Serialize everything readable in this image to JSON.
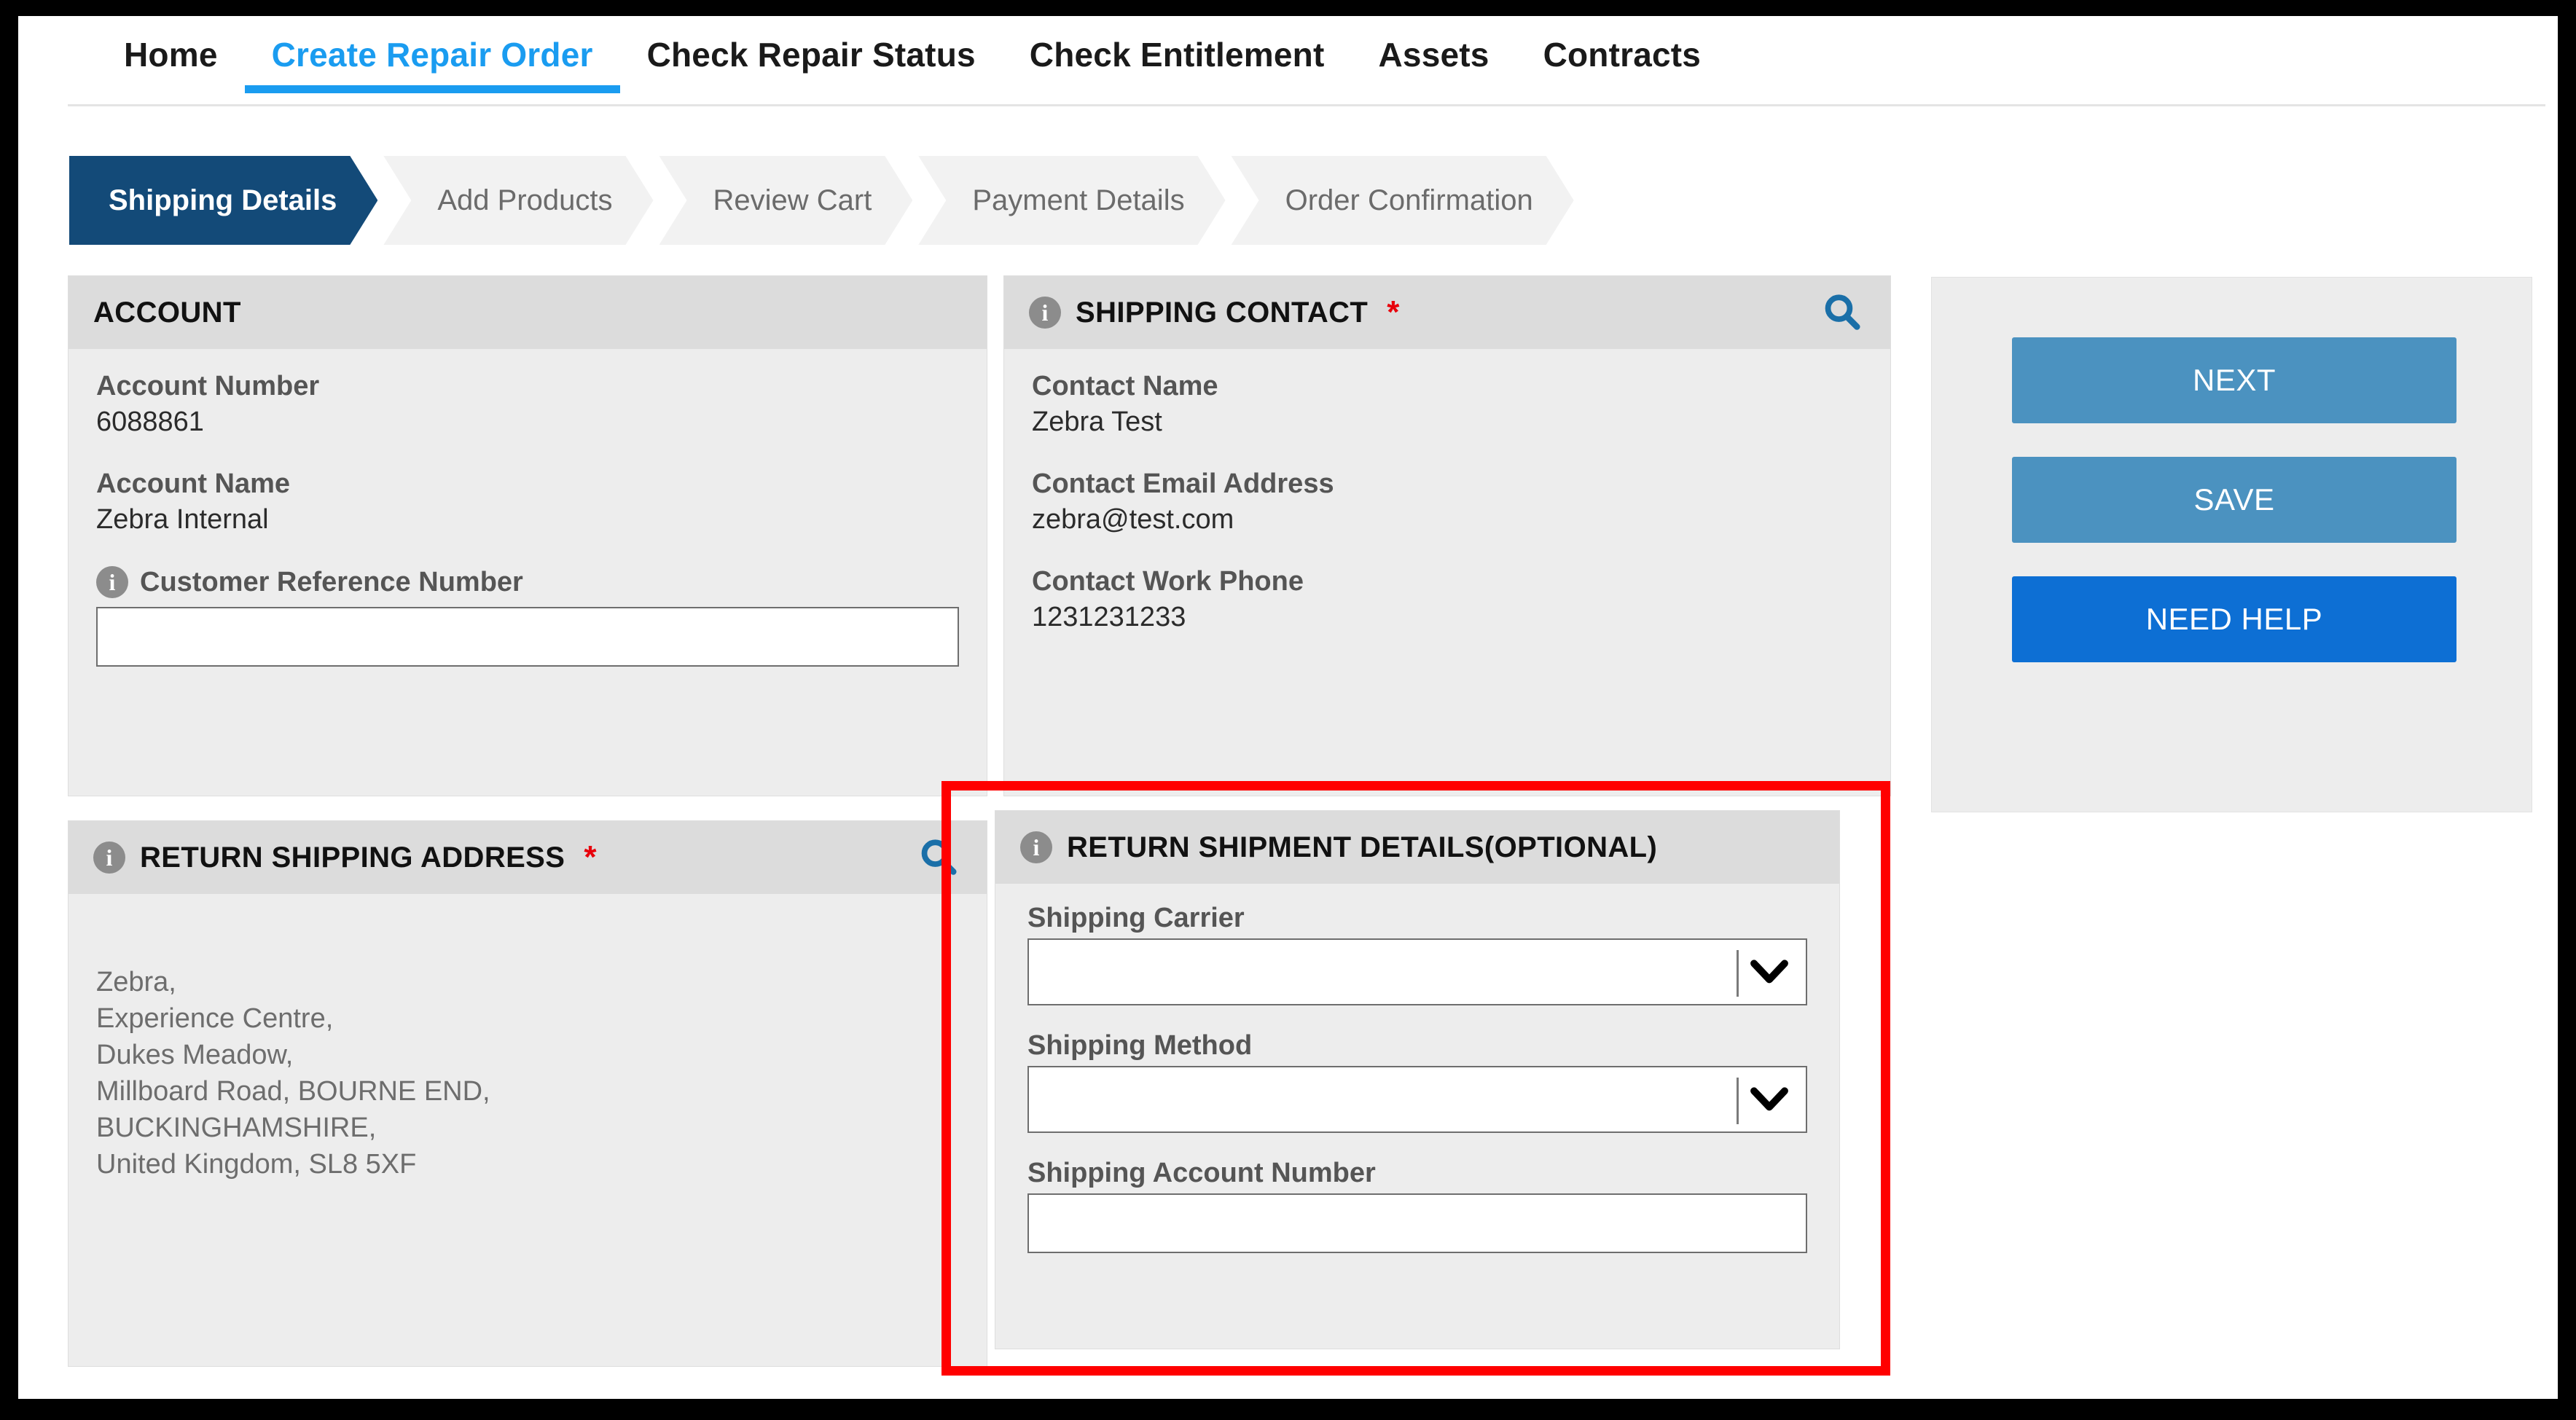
{
  "nav": {
    "items": [
      {
        "label": "Home",
        "active": false
      },
      {
        "label": "Create Repair Order",
        "active": true
      },
      {
        "label": "Check Repair Status",
        "active": false
      },
      {
        "label": "Check Entitlement",
        "active": false
      },
      {
        "label": "Assets",
        "active": false
      },
      {
        "label": "Contracts",
        "active": false
      }
    ]
  },
  "stepper": {
    "steps": [
      {
        "label": "Shipping Details",
        "active": true
      },
      {
        "label": "Add Products",
        "active": false
      },
      {
        "label": "Review Cart",
        "active": false
      },
      {
        "label": "Payment Details",
        "active": false
      },
      {
        "label": "Order Confirmation",
        "active": false
      }
    ]
  },
  "account_panel": {
    "title": "ACCOUNT",
    "account_number_label": "Account Number",
    "account_number_value": "6088861",
    "account_name_label": "Account Name",
    "account_name_value": "Zebra Internal",
    "customer_reference_label": "Customer Reference Number",
    "customer_reference_value": "",
    "customer_reference_placeholder": ""
  },
  "shipping_contact_panel": {
    "title": "SHIPPING CONTACT",
    "required_marker": "*",
    "contact_name_label": "Contact Name",
    "contact_name_value": "Zebra Test",
    "contact_email_label": "Contact Email Address",
    "contact_email_value": "zebra@test.com",
    "contact_phone_label": "Contact Work Phone",
    "contact_phone_value": "1231231233"
  },
  "return_shipping_address_panel": {
    "title": "RETURN SHIPPING ADDRESS",
    "required_marker": "*",
    "address": "Zebra,\nExperience Centre,\nDukes Meadow,\nMillboard Road, BOURNE END,\nBUCKINGHAMSHIRE,\nUnited Kingdom, SL8 5XF"
  },
  "return_shipment_details_panel": {
    "title": "RETURN SHIPMENT DETAILS(OPTIONAL)",
    "shipping_carrier_label": "Shipping Carrier",
    "shipping_carrier_value": "",
    "shipping_method_label": "Shipping Method",
    "shipping_method_value": "",
    "shipping_account_number_label": "Shipping Account Number",
    "shipping_account_number_value": "",
    "shipping_account_number_placeholder": ""
  },
  "actions": {
    "next_label": "NEXT",
    "save_label": "SAVE",
    "need_help_label": "NEED HELP"
  },
  "icons": {
    "info": "info-icon",
    "search": "search-icon",
    "chevron_down": "chevron-down-icon"
  },
  "colors": {
    "accent_blue": "#1a9cf0",
    "step_active": "#134a78",
    "button_secondary": "#4b92c0",
    "button_primary": "#0d6fd4",
    "required_red": "#e8000b",
    "highlight_red": "#ff0000",
    "search_icon_blue": "#1a6fa8"
  }
}
